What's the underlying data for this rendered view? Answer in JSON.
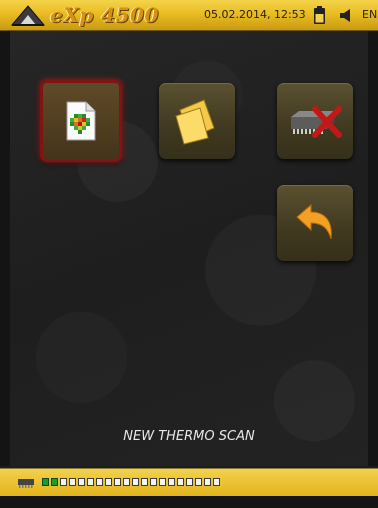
{
  "header": {
    "logo_text": "eXp 4500",
    "datetime": "05.02.2014, 12:53",
    "language": "EN",
    "icons": [
      "logo-triangle-icon",
      "battery-icon",
      "speaker-icon"
    ]
  },
  "main": {
    "tiles": [
      {
        "name": "new-thermo-scan",
        "icon": "thermo-scan-file-icon",
        "selected": true
      },
      {
        "name": "open-files",
        "icon": "files-icon",
        "selected": false
      },
      {
        "name": "delete-memory",
        "icon": "delete-memory-icon",
        "selected": false
      },
      {
        "name": "back",
        "icon": "back-arrow-icon",
        "selected": false
      }
    ],
    "caption": "NEW THERMO SCAN"
  },
  "footer": {
    "memory_icon": "memory-chip-icon",
    "memory_cells_total": 20,
    "memory_cells_used": 2
  },
  "colors": {
    "accent_gold": "#e9bd22",
    "selection_red": "#7e1414",
    "memory_used_green": "#1f9a2f"
  }
}
